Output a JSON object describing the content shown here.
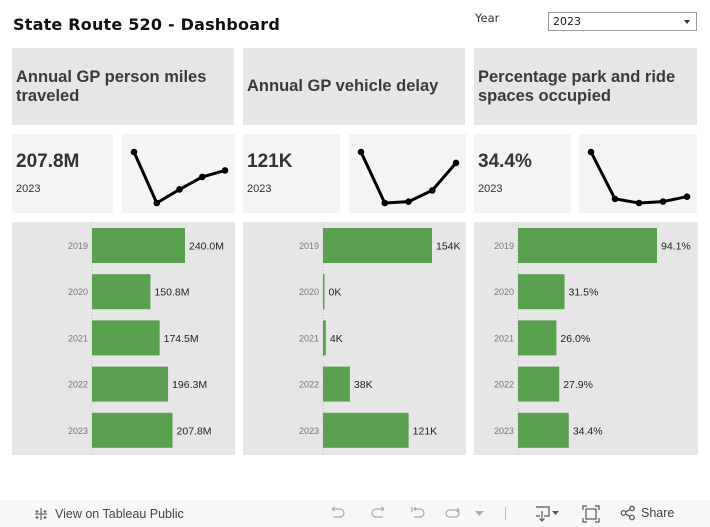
{
  "title": "State Route 520 - Dashboard",
  "filter": {
    "label": "Year",
    "selected": "2023"
  },
  "panels": [
    {
      "heading": "Annual GP person miles traveled",
      "kpi_value": "207.8M",
      "kpi_year": "2023"
    },
    {
      "heading": "Annual GP vehicle delay",
      "kpi_value": "121K",
      "kpi_year": "2023"
    },
    {
      "heading": "Percentage park and ride spaces occupied",
      "kpi_value": "34.4%",
      "kpi_year": "2023"
    }
  ],
  "chart_data": [
    {
      "type": "line",
      "title": "Annual GP person miles traveled (sparkline)",
      "x": [
        "2019",
        "2020",
        "2021",
        "2022",
        "2023"
      ],
      "values": [
        240.0,
        150.8,
        174.5,
        196.3,
        207.8
      ],
      "unit": "M"
    },
    {
      "type": "line",
      "title": "Annual GP vehicle delay (sparkline)",
      "x": [
        "2019",
        "2020",
        "2021",
        "2022",
        "2023"
      ],
      "values": [
        154,
        0,
        4,
        38,
        121
      ],
      "unit": "K"
    },
    {
      "type": "line",
      "title": "Percentage park and ride spaces occupied (sparkline)",
      "x": [
        "2019",
        "2020",
        "2021",
        "2022",
        "2023"
      ],
      "values": [
        94.1,
        31.5,
        26.0,
        27.9,
        34.4
      ],
      "unit": "%"
    },
    {
      "type": "bar",
      "orientation": "horizontal",
      "title": "Annual GP person miles traveled by year",
      "categories": [
        "2019",
        "2020",
        "2021",
        "2022",
        "2023"
      ],
      "values": [
        240.0,
        150.8,
        174.5,
        196.3,
        207.8
      ],
      "labels": [
        "240.0M",
        "150.8M",
        "174.5M",
        "196.3M",
        "207.8M"
      ],
      "color": "#59a14f",
      "xlim": [
        0,
        240.0
      ]
    },
    {
      "type": "bar",
      "orientation": "horizontal",
      "title": "Annual GP vehicle delay by year",
      "categories": [
        "2019",
        "2020",
        "2021",
        "2022",
        "2023"
      ],
      "values": [
        154,
        0.3,
        4,
        38,
        121
      ],
      "labels": [
        "154K",
        "0K",
        "4K",
        "38K",
        "121K"
      ],
      "color": "#59a14f",
      "xlim": [
        0,
        154
      ]
    },
    {
      "type": "bar",
      "orientation": "horizontal",
      "title": "Percentage park and ride spaces occupied by year",
      "categories": [
        "2019",
        "2020",
        "2021",
        "2022",
        "2023"
      ],
      "values": [
        94.1,
        31.5,
        26.0,
        27.9,
        34.4
      ],
      "labels": [
        "94.1%",
        "31.5%",
        "26.0%",
        "27.9%",
        "34.4%"
      ],
      "color": "#59a14f",
      "xlim": [
        0,
        94.1
      ]
    }
  ],
  "footer": {
    "view_link": "View on Tableau Public",
    "share_label": "Share"
  }
}
